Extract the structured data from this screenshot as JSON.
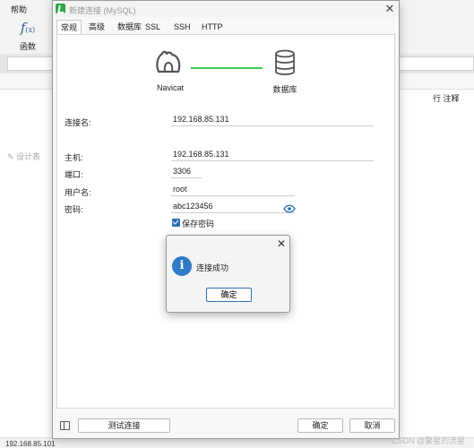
{
  "background": {
    "menu_help": "帮助",
    "function_label": "函数",
    "design_table": "设计表",
    "columns_label": "行 注释",
    "status_text": "192.168.85.101"
  },
  "watermark": "CSDN @繁星的流星",
  "dialog": {
    "title": "新建连接 (MySQL)",
    "tabs": [
      "常规",
      "高级",
      "数据库",
      "SSL",
      "SSH",
      "HTTP"
    ],
    "active_tab": "常规",
    "graphic": {
      "left_label": "Navicat",
      "right_label": "数据库",
      "line_color": "#3ccd58"
    },
    "form": {
      "connection_name_label": "连接名:",
      "connection_name_value": "192.168.85.131",
      "host_label": "主机:",
      "host_value": "192.168.85.131",
      "port_label": "端口:",
      "port_value": "3306",
      "username_label": "用户名:",
      "username_value": "root",
      "password_label": "密码:",
      "password_value": "abc123456",
      "save_password_label": "保存密码",
      "save_password_checked": true
    },
    "footer": {
      "test_button": "测试连接",
      "ok_button": "确定",
      "cancel_button": "取消"
    }
  },
  "message_box": {
    "text": "连接成功",
    "ok_button": "确定",
    "icon": "info-icon"
  },
  "colors": {
    "accent": "#2b6fb5",
    "logo_green": "#2fa54a",
    "info_blue": "#2f79c5"
  }
}
